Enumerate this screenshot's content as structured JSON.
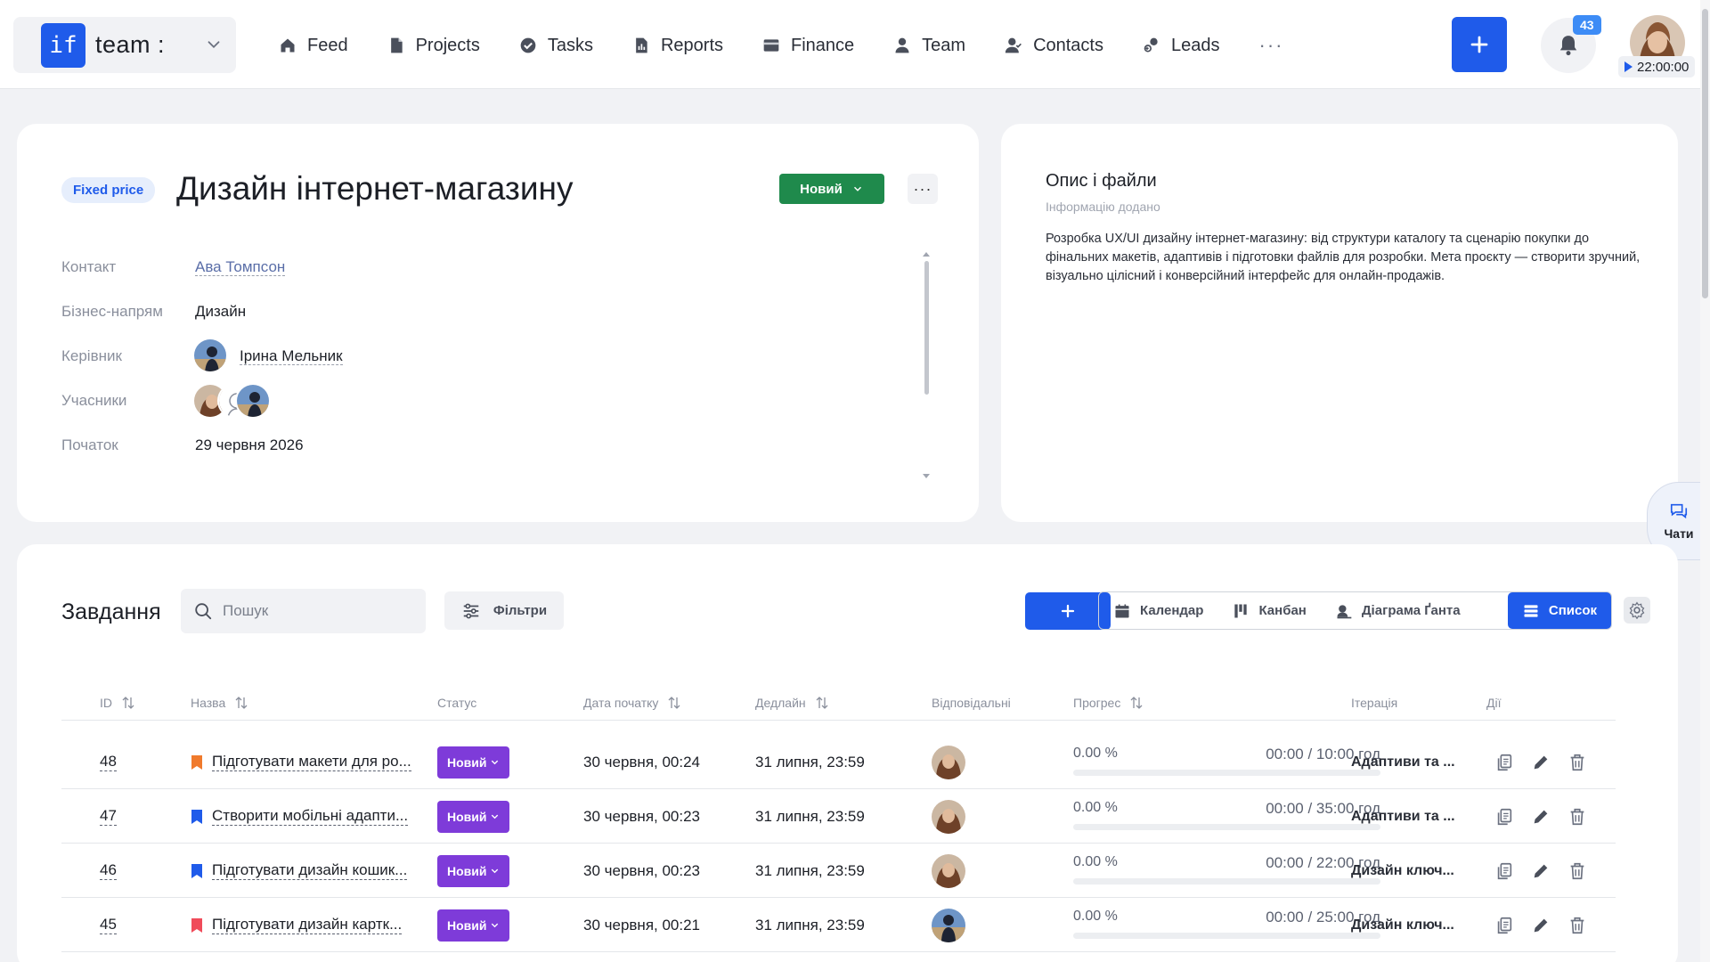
{
  "brand": {
    "logo": "if",
    "name": "team :"
  },
  "nav": [
    {
      "label": "Feed",
      "icon": "home-icon"
    },
    {
      "label": "Projects",
      "icon": "document-icon"
    },
    {
      "label": "Tasks",
      "icon": "check-circle-icon"
    },
    {
      "label": "Reports",
      "icon": "chart-icon"
    },
    {
      "label": "Finance",
      "icon": "wallet-icon"
    },
    {
      "label": "Team",
      "icon": "person-icon"
    },
    {
      "label": "Contacts",
      "icon": "contacts-icon"
    },
    {
      "label": "Leads",
      "icon": "leads-icon"
    }
  ],
  "nav_more": "···",
  "notifications": {
    "count": "43"
  },
  "timer": "22:00:00",
  "project": {
    "badge": "Fixed price",
    "title": "Дизайн інтернет-магазину",
    "status": "Новий",
    "more": "···",
    "fields": [
      {
        "label": "Контакт",
        "value": "Ава Томпсон"
      },
      {
        "label": "Бізнес-напрям",
        "value": "Дизайн"
      },
      {
        "label": "Керівник",
        "value": "Ірина Мельник"
      },
      {
        "label": "Учасники",
        "value": ""
      },
      {
        "label": "Початок",
        "value": "29 червня 2026"
      }
    ]
  },
  "description": {
    "title": "Опис і файли",
    "subtitle": "Інформацію додано",
    "text": "Розробка UX/UI дизайну інтернет-магазину: від структури каталогу та сценарію покупки до фінальних макетів, адаптивів і підготовки файлів для розробки. Мета проєкту — створити зручний, візуально цілісний і конверсійний інтерфейс для онлайн-продажів."
  },
  "chats": {
    "label": "Чати"
  },
  "tasks": {
    "title": "Завдання",
    "search_placeholder": "Пошук",
    "filters_label": "Фільтри",
    "views": [
      {
        "label": "Календар",
        "icon": "calendar-icon"
      },
      {
        "label": "Канбан",
        "icon": "kanban-icon"
      },
      {
        "label": "Діаграма Ґанта",
        "icon": "gantt-icon"
      },
      {
        "label": "Список",
        "icon": "list-icon",
        "active": true
      }
    ],
    "columns": {
      "id": "ID",
      "name": "Назва",
      "status": "Статус",
      "start": "Дата початку",
      "deadline": "Дедлайн",
      "responsible": "Відповідальні",
      "progress": "Прогрес",
      "iteration": "Ітерація",
      "actions": "Дії"
    },
    "rows": [
      {
        "id": "48",
        "name": "Підготувати макети для ро...",
        "flag_color": "#f07a2c",
        "status": "Новий",
        "start": "30 червня, 00:24",
        "deadline": "31 липня, 23:59",
        "progress_pct": "0.00 %",
        "progress_value": 0,
        "time": "00:00 / 10:00 год",
        "iteration": "Адаптиви та ...",
        "avatar": "woman"
      },
      {
        "id": "47",
        "name": "Створити мобільні адапти...",
        "flag_color": "#1f5bea",
        "status": "Новий",
        "start": "30 червня, 00:23",
        "deadline": "31 липня, 23:59",
        "progress_pct": "0.00 %",
        "progress_value": 0,
        "time": "00:00 / 35:00 год",
        "iteration": "Адаптиви та ...",
        "avatar": "woman"
      },
      {
        "id": "46",
        "name": "Підготувати дизайн кошик...",
        "flag_color": "#1f5bea",
        "status": "Новий",
        "start": "30 червня, 00:23",
        "deadline": "31 липня, 23:59",
        "progress_pct": "0.00 %",
        "progress_value": 0,
        "time": "00:00 / 22:00 год",
        "iteration": "Дизайн ключ...",
        "avatar": "woman"
      },
      {
        "id": "45",
        "name": "Підготувати дизайн картк...",
        "flag_color": "#f04b5a",
        "status": "Новий",
        "start": "30 червня, 00:21",
        "deadline": "31 липня, 23:59",
        "progress_pct": "0.00 %",
        "progress_value": 0,
        "time": "00:00 / 25:00 год",
        "iteration": "Дизайн ключ...",
        "avatar": "man"
      }
    ]
  },
  "colors": {
    "primary": "#1f5bea",
    "status_green": "#1f8a4c",
    "status_purple": "#7e3bd9",
    "badge_blue": "#3d8cf6"
  }
}
